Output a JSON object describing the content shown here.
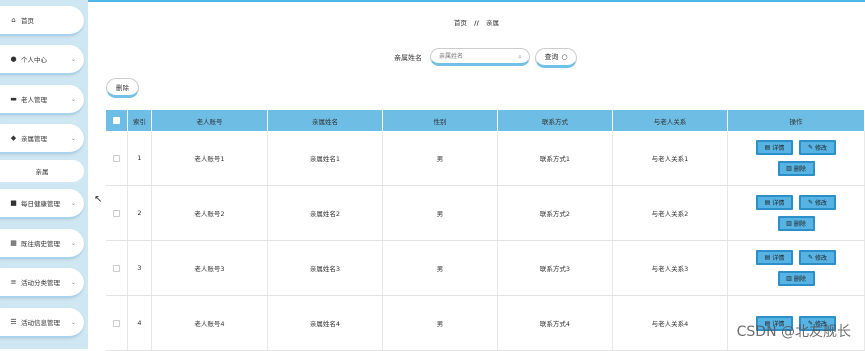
{
  "sidebar": {
    "items": [
      {
        "icon": "home-icon",
        "glyph": "⌂",
        "label": "首页",
        "has_chevron": false
      },
      {
        "icon": "user-icon",
        "glyph": "●",
        "label": "个人中心",
        "has_chevron": true
      },
      {
        "icon": "briefcase-icon",
        "glyph": "▬",
        "label": "老人管理",
        "has_chevron": true
      },
      {
        "icon": "cup-icon",
        "glyph": "◆",
        "label": "亲属管理",
        "has_chevron": true
      },
      {
        "icon": "calendar-icon",
        "glyph": "■",
        "label": "每日健康管理",
        "has_chevron": true
      },
      {
        "icon": "grid-icon",
        "glyph": "▦",
        "label": "既往病史管理",
        "has_chevron": true
      },
      {
        "icon": "list-icon",
        "glyph": "≡",
        "label": "活动分类管理",
        "has_chevron": true
      },
      {
        "icon": "sliders-icon",
        "glyph": "☰",
        "label": "活动信息管理",
        "has_chevron": true
      }
    ],
    "sub_item": {
      "label": "亲属"
    }
  },
  "breadcrumb": {
    "home": "首页",
    "separator": "//",
    "current": "亲属"
  },
  "search": {
    "label": "亲属姓名",
    "placeholder": "亲属姓名",
    "button_label": "查询"
  },
  "toolbar": {
    "delete_label": "删除"
  },
  "table": {
    "headers": [
      "索引",
      "老人账号",
      "亲属姓名",
      "性别",
      "联系方式",
      "与老人关系",
      "操作"
    ],
    "rows": [
      {
        "index": "1",
        "account": "老人账号1",
        "name": "亲属姓名1",
        "gender": "男",
        "contact": "联系方式1",
        "relation": "与老人关系1"
      },
      {
        "index": "2",
        "account": "老人账号2",
        "name": "亲属姓名2",
        "gender": "男",
        "contact": "联系方式2",
        "relation": "与老人关系2"
      },
      {
        "index": "3",
        "account": "老人账号3",
        "name": "亲属姓名3",
        "gender": "男",
        "contact": "联系方式3",
        "relation": "与老人关系3"
      },
      {
        "index": "4",
        "account": "老人账号4",
        "name": "亲属姓名4",
        "gender": "男",
        "contact": "联系方式4",
        "relation": "与老人关系4"
      }
    ],
    "actions": {
      "detail": "详情",
      "edit": "修改",
      "delete": "删除"
    }
  },
  "watermark": "CSDN @北友舰长",
  "colors": {
    "accent": "#6dbde4",
    "sidebar_bg": "#cfe6f3",
    "button_bg": "#56b3e3",
    "button_border": "#2c8fc8"
  }
}
